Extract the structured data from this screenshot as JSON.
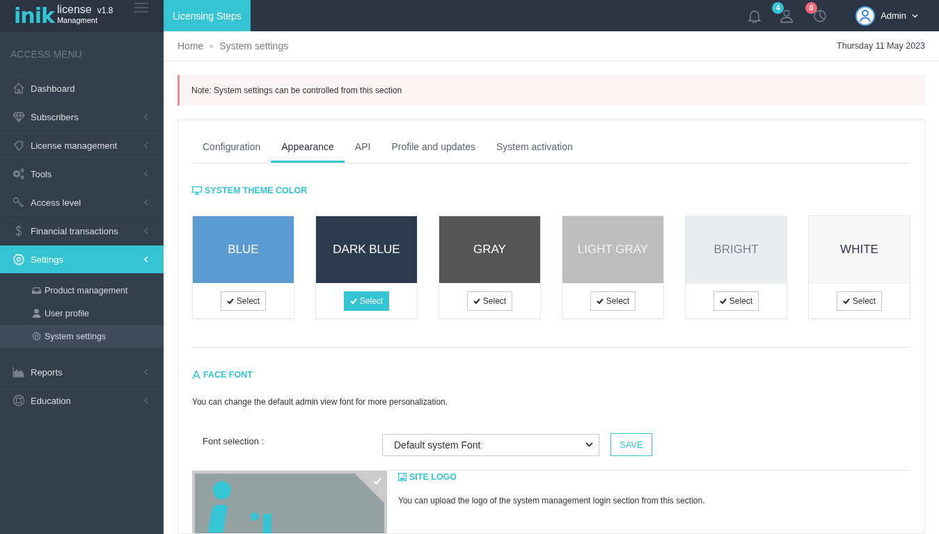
{
  "brand": {
    "logo": "inik",
    "name": "license",
    "version": "v1.8",
    "subtitle": "Managment"
  },
  "topbar": {
    "steps_button": "Licensing Steps",
    "badges": [
      {
        "kind": "users",
        "count": "4",
        "color": "#35c4d4"
      },
      {
        "kind": "chart",
        "count": "0",
        "color": "#ee6876"
      }
    ],
    "user": "Admin"
  },
  "sidebar": {
    "heading": "ACCESS MENU",
    "items": [
      {
        "label": "Dashboard",
        "selected": false,
        "chevron": false
      },
      {
        "label": "Subscribers",
        "selected": false,
        "chevron": true
      },
      {
        "label": "License management",
        "selected": false,
        "chevron": true
      },
      {
        "label": "Tools",
        "selected": false,
        "chevron": true
      },
      {
        "label": "Access level",
        "selected": false,
        "chevron": true
      },
      {
        "label": "Financial transactions",
        "selected": false,
        "chevron": true
      },
      {
        "label": "Settings",
        "selected": true,
        "chevron": true,
        "children": [
          {
            "label": "Product management",
            "selected": false
          },
          {
            "label": "User profile",
            "selected": false
          },
          {
            "label": "System settings",
            "selected": true
          }
        ]
      },
      {
        "label": "Reports",
        "selected": false,
        "chevron": true
      },
      {
        "label": "Education",
        "selected": false,
        "chevron": true
      }
    ]
  },
  "breadcrumb": [
    "Home",
    "System settings"
  ],
  "date": "Thursday 11 May 2023",
  "note": "Note: System settings can be controlled from this section",
  "tabs": [
    {
      "label": "Configuration",
      "selected": false
    },
    {
      "label": "Appearance",
      "selected": true
    },
    {
      "label": "API",
      "selected": false
    },
    {
      "label": "Profile and updates",
      "selected": false
    },
    {
      "label": "System activation",
      "selected": false
    }
  ],
  "theme_section": {
    "title": "SYSTEM THEME COLOR",
    "themes": [
      {
        "name": "BLUE",
        "color": "#5b9bd1",
        "button": "Select",
        "selected": false
      },
      {
        "name": "DARK BLUE",
        "color": "#2d3b4e",
        "button": "Select",
        "selected": true
      },
      {
        "name": "GRAY",
        "color": "#555555",
        "button": "Select",
        "selected": false
      },
      {
        "name": "LIGHT GRAY",
        "color": "#bdbdbd",
        "button": "Select",
        "selected": false
      },
      {
        "name": "BRIGHT",
        "color": "#e9edf0",
        "button": "Select",
        "selected": false
      },
      {
        "name": "WHITE",
        "color": "#f7f7f7",
        "button": "Select",
        "selected": false
      }
    ]
  },
  "font_section": {
    "title": "FACE FONT",
    "description": "You can change the default admin view font for more personalization.",
    "field_label": "Font selection :",
    "value": "Default system Font",
    "save": "SAVE"
  },
  "logo_section": {
    "title": "SITE LOGO",
    "description": "You can upload the logo of the system management login section from this section."
  }
}
